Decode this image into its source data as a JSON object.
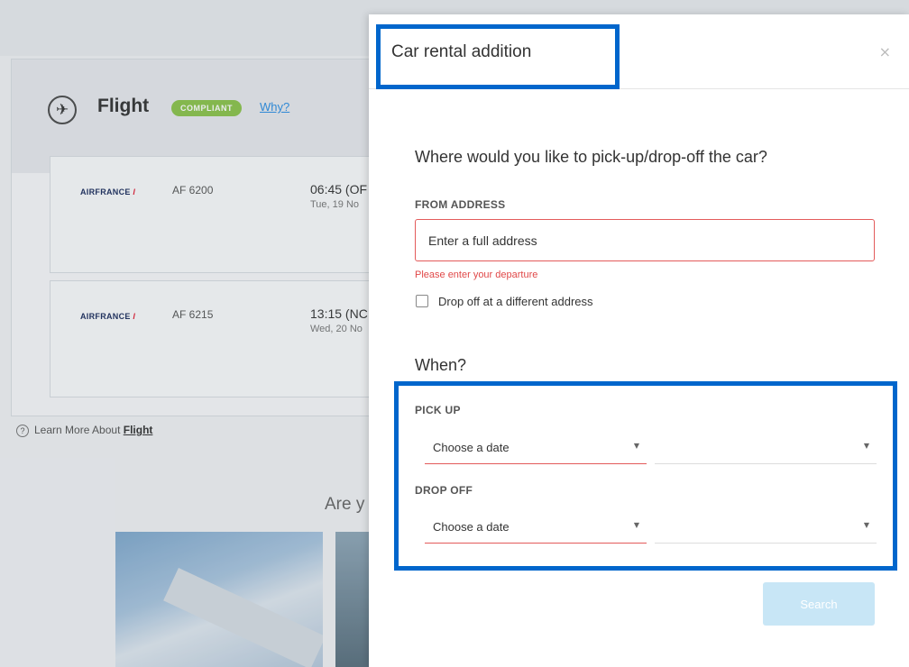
{
  "background": {
    "flight_section": {
      "title": "Flight",
      "badge": "COMPLIANT",
      "why_link": "Why?",
      "plane_icon": "plane-departure-icon",
      "legs": [
        {
          "airline": "AIRFRANCE",
          "flight_no": "AF 6200",
          "time": "06:45 (OF",
          "date": "Tue, 19 No"
        },
        {
          "airline": "AIRFRANCE",
          "flight_no": "AF 6215",
          "time": "13:15 (NC",
          "date": "Wed, 20 No"
        }
      ]
    },
    "learn_more": {
      "prefix": "Learn More About ",
      "link": "Flight"
    },
    "promo_heading": "Are y"
  },
  "modal": {
    "title": "Car rental addition",
    "close_label": "×",
    "location_question": "Where would you like to pick-up/drop-off the car?",
    "from_address": {
      "label": "FROM ADDRESS",
      "placeholder": "Enter a full address",
      "error": "Please enter your departure"
    },
    "different_dropoff": {
      "label": "Drop off at a different address",
      "checked": false
    },
    "when_heading": "When?",
    "pick_up": {
      "label": "PICK UP",
      "date_value": "Choose a date",
      "time_value": ""
    },
    "drop_off": {
      "label": "DROP OFF",
      "date_value": "Choose a date",
      "time_value": ""
    },
    "search_button": "Search"
  },
  "colors": {
    "highlight_border": "#0066cc",
    "error": "#e04848",
    "badge_green": "#8bc34a",
    "search_disabled": "#c8e6f6"
  }
}
